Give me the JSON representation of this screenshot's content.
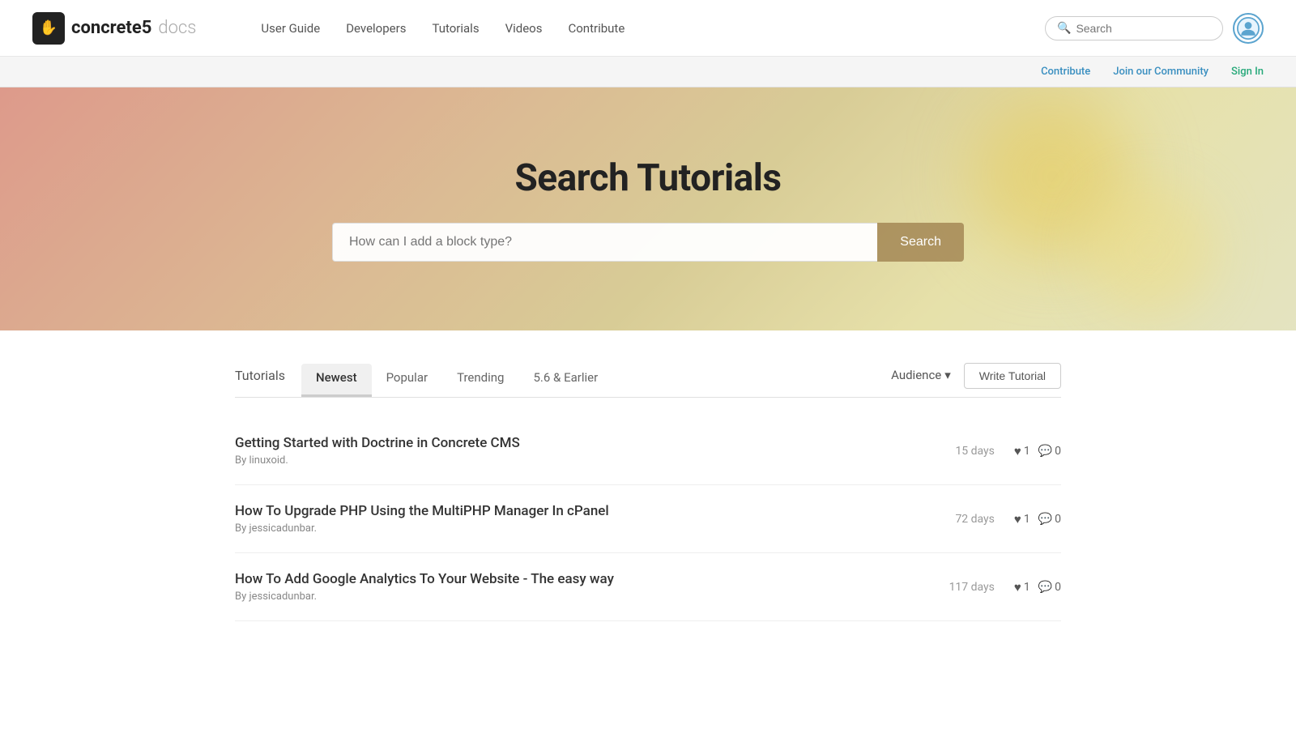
{
  "header": {
    "logo_brand": "concrete5",
    "logo_docs": "docs",
    "logo_icon": "✋",
    "nav": [
      {
        "label": "User Guide",
        "href": "#"
      },
      {
        "label": "Developers",
        "href": "#"
      },
      {
        "label": "Tutorials",
        "href": "#"
      },
      {
        "label": "Videos",
        "href": "#"
      },
      {
        "label": "Contribute",
        "href": "#"
      }
    ],
    "search_placeholder": "Search"
  },
  "sub_header": {
    "contribute_label": "Contribute",
    "community_label": "Join our Community",
    "signin_label": "Sign In"
  },
  "hero": {
    "title": "Search Tutorials",
    "search_placeholder": "How can I add a block type?",
    "search_button": "Search"
  },
  "tabs": {
    "label": "Tutorials",
    "items": [
      {
        "label": "Newest",
        "active": true
      },
      {
        "label": "Popular",
        "active": false
      },
      {
        "label": "Trending",
        "active": false
      },
      {
        "label": "5.6 & Earlier",
        "active": false
      }
    ],
    "audience_label": "Audience",
    "write_button": "Write Tutorial"
  },
  "tutorials": [
    {
      "title": "Getting Started with Doctrine in Concrete CMS",
      "author": "linuxoid",
      "age": "15 days",
      "likes": "1",
      "comments": "0"
    },
    {
      "title": "How To Upgrade PHP Using the MultiPHP Manager In cPanel",
      "author": "jessicadunbar",
      "age": "72 days",
      "likes": "1",
      "comments": "0"
    },
    {
      "title": "How To Add Google Analytics To Your Website - The easy way",
      "author": "jessicadunbar",
      "age": "117 days",
      "likes": "1",
      "comments": "0"
    }
  ],
  "colors": {
    "link_blue": "#3a8fc0",
    "link_green": "#27a97a"
  }
}
